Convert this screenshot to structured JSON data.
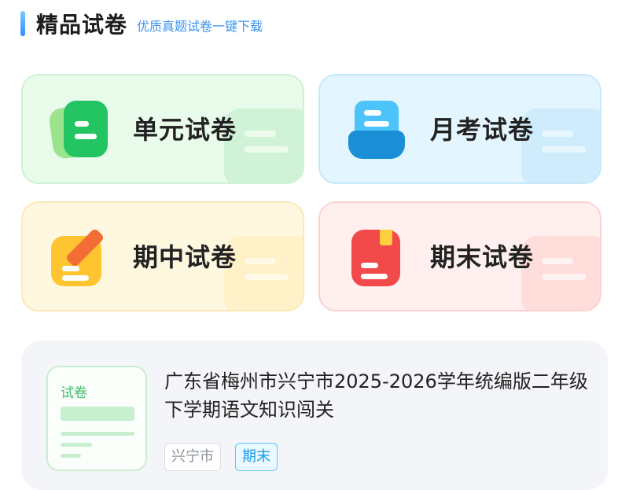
{
  "header": {
    "title": "精品试卷",
    "subtitle": "优质真题试卷一键下载"
  },
  "cards": [
    {
      "label": "单元试卷",
      "icon": "document-icon",
      "color": "#22c562"
    },
    {
      "label": "月考试卷",
      "icon": "inbox-tray-icon",
      "color": "#29a8ee"
    },
    {
      "label": "期中试卷",
      "icon": "pencil-note-icon",
      "color": "#ffc531"
    },
    {
      "label": "期末试卷",
      "icon": "bookmark-book-icon",
      "color": "#f24a4a"
    }
  ],
  "paper": {
    "thumb_label": "试卷",
    "title": "广东省梅州市兴宁市2025-2026学年统编版二年级下学期语文知识闯关",
    "tags": [
      "兴宁市",
      "期末"
    ]
  }
}
